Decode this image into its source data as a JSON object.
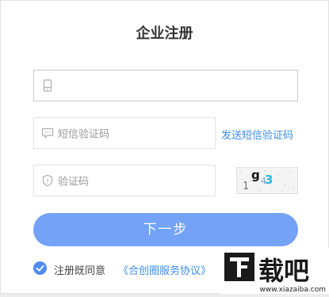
{
  "title": "企业注册",
  "phone": {
    "placeholder": ""
  },
  "sms": {
    "placeholder": "短信验证码",
    "send_label": "发送短信验证码"
  },
  "code": {
    "placeholder": "验证码"
  },
  "captcha": {
    "chars": [
      "1",
      "g",
      "4",
      "3"
    ]
  },
  "next_button": "下一步",
  "agreement": {
    "label": "注册既同意",
    "link": "《合创圈服务协议》",
    "checked": true
  },
  "watermark": {
    "logo": "下载吧",
    "url": "www.xiazaiba.com"
  },
  "colors": {
    "accent": "#3d8ee6",
    "button": "#73a2f7",
    "check": "#4f8ef0"
  }
}
